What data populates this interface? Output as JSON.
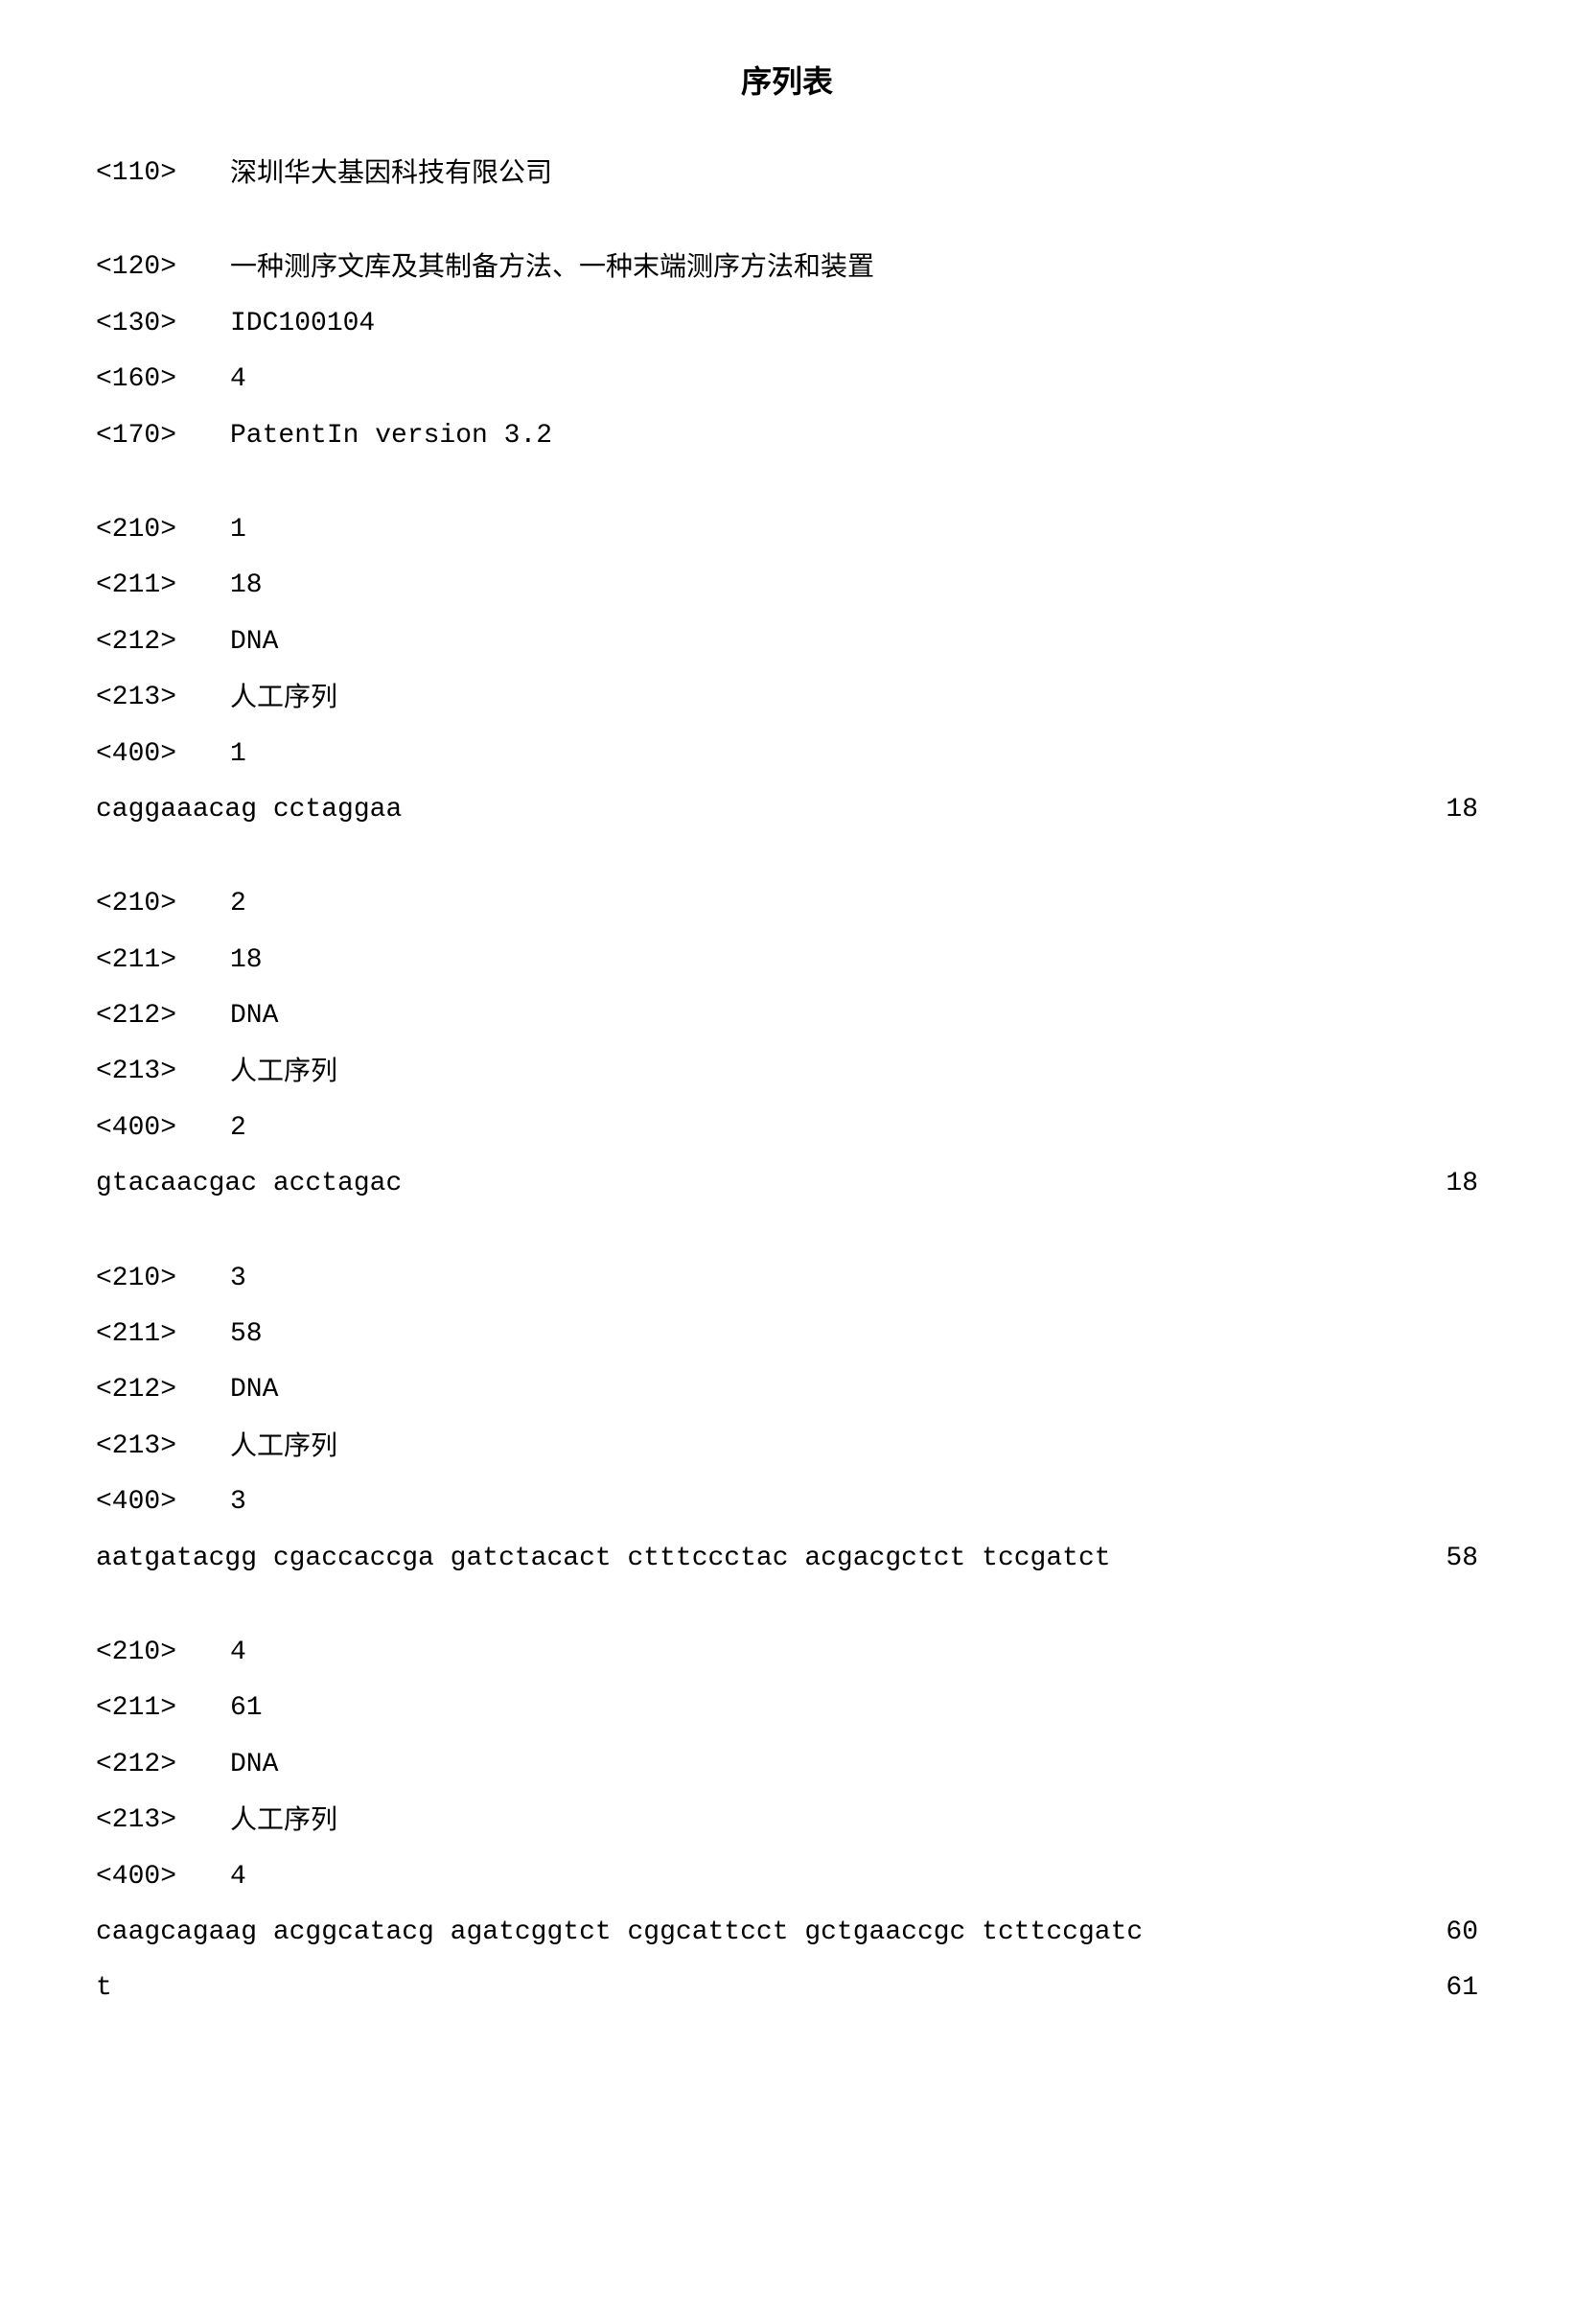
{
  "title": "序列表",
  "header": {
    "tag110": "<110>",
    "val110": "深圳华大基因科技有限公司",
    "tag120": "<120>",
    "val120": "一种测序文库及其制备方法、一种末端测序方法和装置",
    "tag130": "<130>",
    "val130": "IDC100104",
    "tag160": "<160>",
    "val160": "4",
    "tag170": "<170>",
    "val170": "PatentIn version 3.2"
  },
  "sequences": [
    {
      "tag210": "<210>",
      "val210": "1",
      "tag211": "<211>",
      "val211": "18",
      "tag212": "<212>",
      "val212": "DNA",
      "tag213": "<213>",
      "val213": "人工序列",
      "tag400": "<400>",
      "val400": "1",
      "lines": [
        {
          "seq": "caggaaacag cctaggaa",
          "num": "18"
        }
      ]
    },
    {
      "tag210": "<210>",
      "val210": "2",
      "tag211": "<211>",
      "val211": "18",
      "tag212": "<212>",
      "val212": "DNA",
      "tag213": "<213>",
      "val213": "人工序列",
      "tag400": "<400>",
      "val400": "2",
      "lines": [
        {
          "seq": "gtacaacgac acctagac",
          "num": "18"
        }
      ]
    },
    {
      "tag210": "<210>",
      "val210": "3",
      "tag211": "<211>",
      "val211": "58",
      "tag212": "<212>",
      "val212": "DNA",
      "tag213": "<213>",
      "val213": "人工序列",
      "tag400": "<400>",
      "val400": "3",
      "lines": [
        {
          "seq": "aatgatacgg cgaccaccga gatctacact ctttccctac acgacgctct tccgatct",
          "num": "58"
        }
      ]
    },
    {
      "tag210": "<210>",
      "val210": "4",
      "tag211": "<211>",
      "val211": "61",
      "tag212": "<212>",
      "val212": "DNA",
      "tag213": "<213>",
      "val213": "人工序列",
      "tag400": "<400>",
      "val400": "4",
      "lines": [
        {
          "seq": "caagcagaag acggcatacg agatcggtct cggcattcct gctgaaccgc tcttccgatc",
          "num": "60"
        },
        {
          "seq": "t",
          "num": "61"
        }
      ]
    }
  ]
}
